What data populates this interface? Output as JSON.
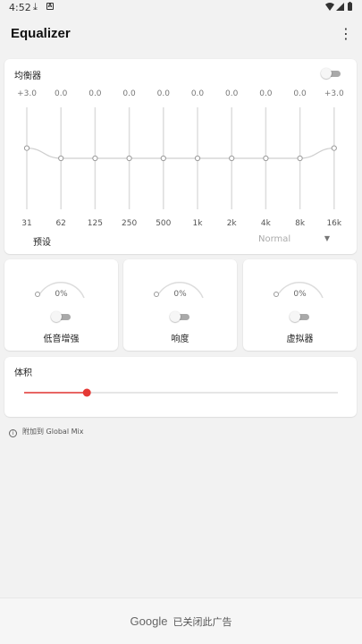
{
  "status_bar": {
    "time": "4:52",
    "download_icon": "download-icon",
    "notification_icon": "app-notification-icon",
    "wifi_icon": "wifi-icon",
    "signal_icon": "signal-icon",
    "battery_icon": "battery-icon"
  },
  "app_bar": {
    "title": "Equalizer",
    "menu_icon": "more-vert-icon"
  },
  "equalizer": {
    "label": "均衡器",
    "enabled": false,
    "bands": [
      {
        "freq": "31",
        "gain_label": "+3.0",
        "gain": 3.0
      },
      {
        "freq": "62",
        "gain_label": "0.0",
        "gain": 0.0
      },
      {
        "freq": "125",
        "gain_label": "0.0",
        "gain": 0.0
      },
      {
        "freq": "250",
        "gain_label": "0.0",
        "gain": 0.0
      },
      {
        "freq": "500",
        "gain_label": "0.0",
        "gain": 0.0
      },
      {
        "freq": "1k",
        "gain_label": "0.0",
        "gain": 0.0
      },
      {
        "freq": "2k",
        "gain_label": "0.0",
        "gain": 0.0
      },
      {
        "freq": "4k",
        "gain_label": "0.0",
        "gain": 0.0
      },
      {
        "freq": "8k",
        "gain_label": "0.0",
        "gain": 0.0
      },
      {
        "freq": "16k",
        "gain_label": "+3.0",
        "gain": 3.0
      }
    ],
    "gain_range": [
      -15,
      15
    ],
    "preset": {
      "label": "预设",
      "value": "Normal"
    }
  },
  "effects": [
    {
      "name": "bass-boost",
      "label": "低音增强",
      "percent_label": "0%",
      "percent": 0,
      "enabled": false
    },
    {
      "name": "loudness",
      "label": "响度",
      "percent_label": "0%",
      "percent": 0,
      "enabled": false
    },
    {
      "name": "virtualizer",
      "label": "虚拟器",
      "percent_label": "0%",
      "percent": 0,
      "enabled": false
    }
  ],
  "volume": {
    "label": "体积",
    "level": 0.2,
    "accent_color": "#e53935"
  },
  "footnote": {
    "text": "附加到 Global Mix"
  },
  "ad_banner": {
    "brand": "Google",
    "text": "已关闭此广告"
  },
  "colors": {
    "accent": "#e53935",
    "toggle_track_off": "#a9a9a9",
    "slider_line": "#dddddd",
    "background": "#f2f2f2"
  }
}
